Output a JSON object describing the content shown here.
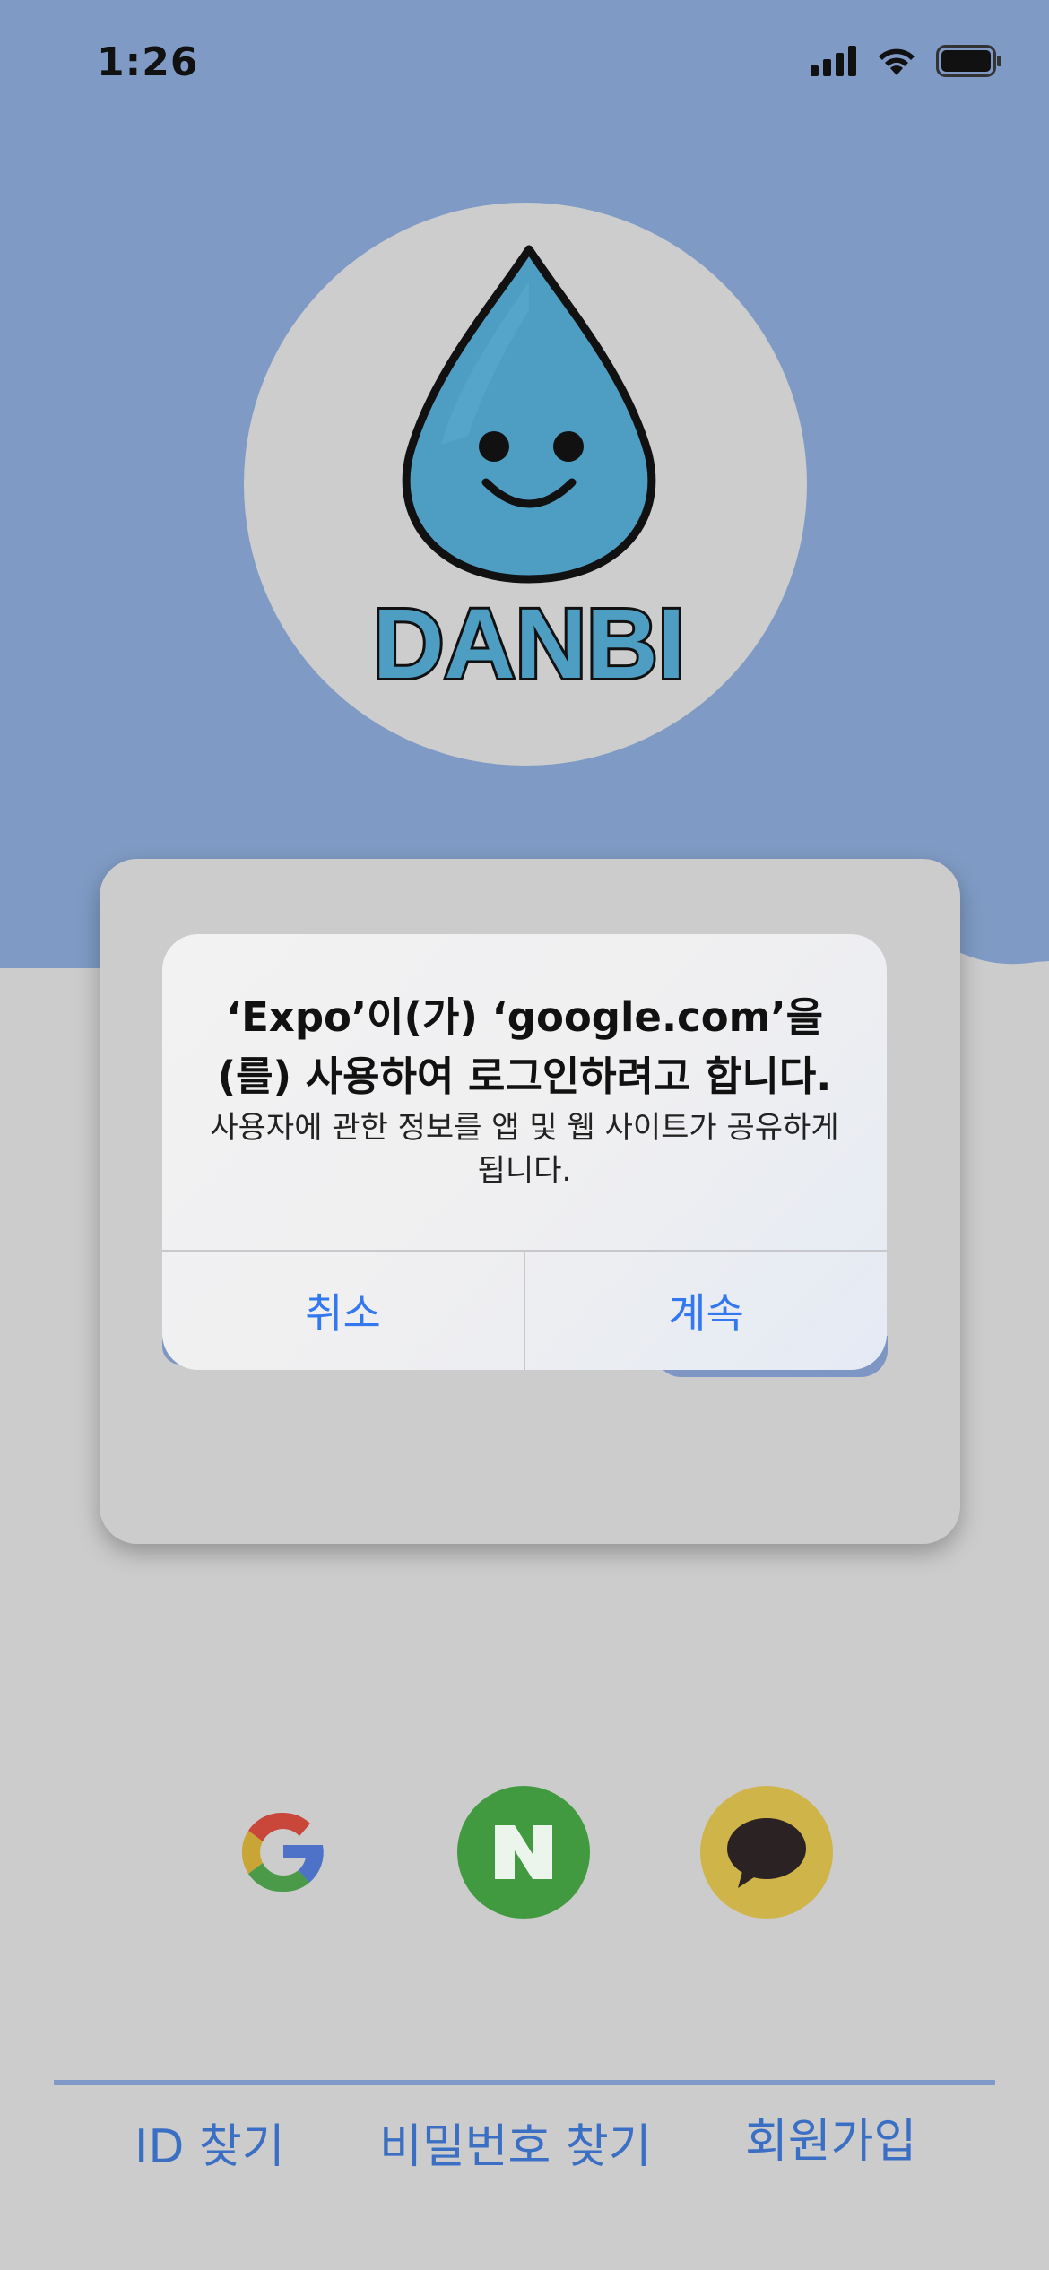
{
  "status_bar": {
    "time": "1:26",
    "icons": [
      "cellular-signal-icon",
      "wifi-icon",
      "battery-icon"
    ]
  },
  "colors": {
    "header_blue": "#7f9bc5",
    "background_gray": "#cccccc",
    "link_blue": "#3a6fc4",
    "alert_button_blue": "#3478f0",
    "naver_green": "#419a3f",
    "kakao_yellow": "#cfb44a"
  },
  "logo": {
    "text": "DANBI",
    "icon": "water-drop-smiley-icon"
  },
  "alert": {
    "title": "‘Expo’이(가) ‘google.com’을(를) 사용하여 로그인하려고 합니다.",
    "message": "사용자에 관한 정보를 앱 및 웹 사이트가 공유하게 됩니다.",
    "cancel_label": "취소",
    "continue_label": "계속"
  },
  "social_login": [
    {
      "name": "google",
      "icon": "google-icon"
    },
    {
      "name": "naver",
      "icon": "naver-icon"
    },
    {
      "name": "kakao",
      "icon": "kakao-talk-icon"
    }
  ],
  "footer_links": {
    "find_id": "ID 찾기",
    "find_password": "비밀번호 찾기",
    "signup": "회원가입"
  }
}
